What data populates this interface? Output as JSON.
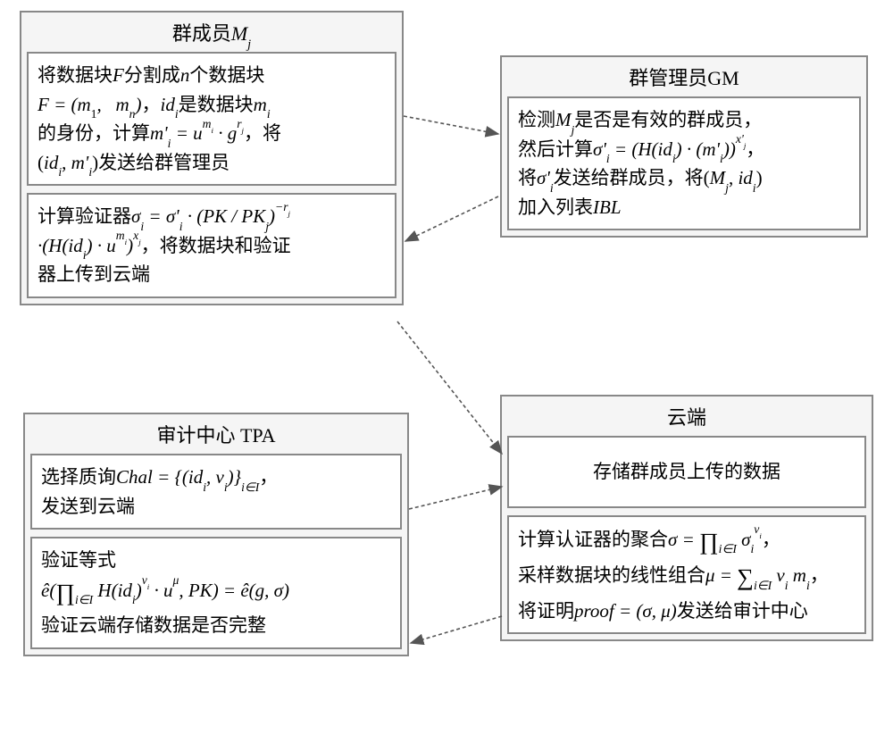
{
  "member": {
    "title": "群成员Mⱼ",
    "b1": {
      "l1a": "将数据块",
      "l1b": "分割成",
      "l1c": "个数据块",
      "l2a": "是数据块",
      "l2b": "",
      "l3a": "的身份，计算",
      "l3b": "，将",
      "l4a": "发送给群管理员"
    },
    "b2": {
      "l1a": "计算验证器",
      "l2a": "，将数据块和验证",
      "l3": "器上传到云端"
    }
  },
  "gm": {
    "title": "群管理员GM",
    "b1": {
      "l1a": "检测",
      "l1b": "是否是有效的群成员，",
      "l2a": "然后计算",
      "l2b": "，",
      "l3a": "将",
      "l3b": "发送给群成员，将",
      "l4a": "加入列表"
    }
  },
  "tpa": {
    "title": "审计中心 TPA",
    "b1": {
      "l1a": "选择质询",
      "l1b": "，",
      "l2": "发送到云端"
    },
    "b2": {
      "l1": "验证等式",
      "l3": "验证云端存储数据是否完整"
    }
  },
  "cloud": {
    "title": "云端",
    "b1": {
      "l1": "存储群成员上传的数据"
    },
    "b2": {
      "l1a": "计算认证器的聚合",
      "l1b": "，",
      "l2a": "采样数据块的线性组合",
      "l2b": "，",
      "l3a": "将证明",
      "l3b": "发送给审计中心"
    }
  },
  "chart_data": {
    "type": "table",
    "title": "Protocol message flow between four entities",
    "entities": [
      "群成员 Mⱼ (Group Member)",
      "群管理员 GM (Group Manager)",
      "审计中心 TPA (Audit Center)",
      "云端 (Cloud)"
    ],
    "steps": [
      {
        "from": "Mⱼ",
        "to": "GM",
        "action": "Split F into n blocks (m₁,…,mₙ); idᵢ is identity of mᵢ; compute m'ᵢ = u^{mᵢ}·g^{rⱼ}; send (idᵢ, m'ᵢ)"
      },
      {
        "from": "GM",
        "to": "Mⱼ",
        "action": "Verify Mⱼ is valid member; compute σ'ᵢ = (H(idᵢ)·(m'ᵢ))^{x'ⱼ}; send σ'ᵢ; add (Mⱼ, idᵢ) to list IBL"
      },
      {
        "from": "Mⱼ",
        "to": "云端",
        "action": "Compute verifier σᵢ = σ'ᵢ·(PK/PKⱼ)^{-rⱼ}·(H(idᵢ)·u^{mᵢ})^{xⱼ}; upload data blocks and verifiers"
      },
      {
        "from": "云端",
        "to": "—",
        "action": "Store data uploaded by group members"
      },
      {
        "from": "TPA",
        "to": "云端",
        "action": "Choose challenge Chal = {(idᵢ, vᵢ)}_{i∈I}; send to cloud"
      },
      {
        "from": "云端",
        "to": "TPA",
        "action": "Compute aggregation σ = ∏_{i∈I} σᵢ^{vᵢ}, linear combination μ = Σ_{i∈I} vᵢ mᵢ; send proof = (σ, μ)"
      },
      {
        "from": "TPA",
        "to": "—",
        "action": "Verify equation ê(∏_{i∈I} H(idᵢ)^{vᵢ}·u^{μ}, PK) = ê(g, σ); check cloud data integrity"
      }
    ]
  }
}
